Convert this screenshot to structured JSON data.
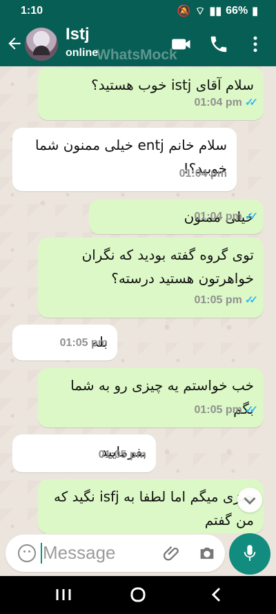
{
  "status": {
    "time": "1:10",
    "battery": "66%"
  },
  "header": {
    "contact_name": "Istj",
    "contact_status": "online",
    "watermark": "WhatsMock"
  },
  "messages": [
    {
      "text": "سلام آقای istj خوب هستید؟",
      "time": "01:04 pm"
    },
    {
      "text": "سلام خانم entj خیلی ممنون شما خوبید؟!",
      "time": "01:04 pm"
    },
    {
      "text": "خیلی ممنون",
      "time": "01:04 pm"
    },
    {
      "text": "توی گروه گفته بودید که نگران خواهرتون هستید درسته؟",
      "time": "01:05 pm"
    },
    {
      "text": "بله",
      "time": "01:05 pm"
    },
    {
      "text": "خب خواستم یه چیزی رو به شما بگم",
      "time": "01:05 pm"
    },
    {
      "text": "بفرمایید",
      "time": "01:05 pm"
    },
    {
      "text": "چیزی میگم اما لطفا به isfj نگید که من گفتم",
      "time": ""
    }
  ],
  "input": {
    "placeholder": "Message"
  },
  "colors": {
    "header": "#075e54",
    "outgoing": "#dcf8c6",
    "incoming": "#ffffff",
    "accent": "#128c7e"
  },
  "icons": {
    "back": "arrow-left",
    "video": "video-call",
    "call": "phone",
    "more": "more-vertical",
    "emoji": "emoji",
    "attach": "paperclip",
    "camera": "camera",
    "mic": "microphone"
  }
}
